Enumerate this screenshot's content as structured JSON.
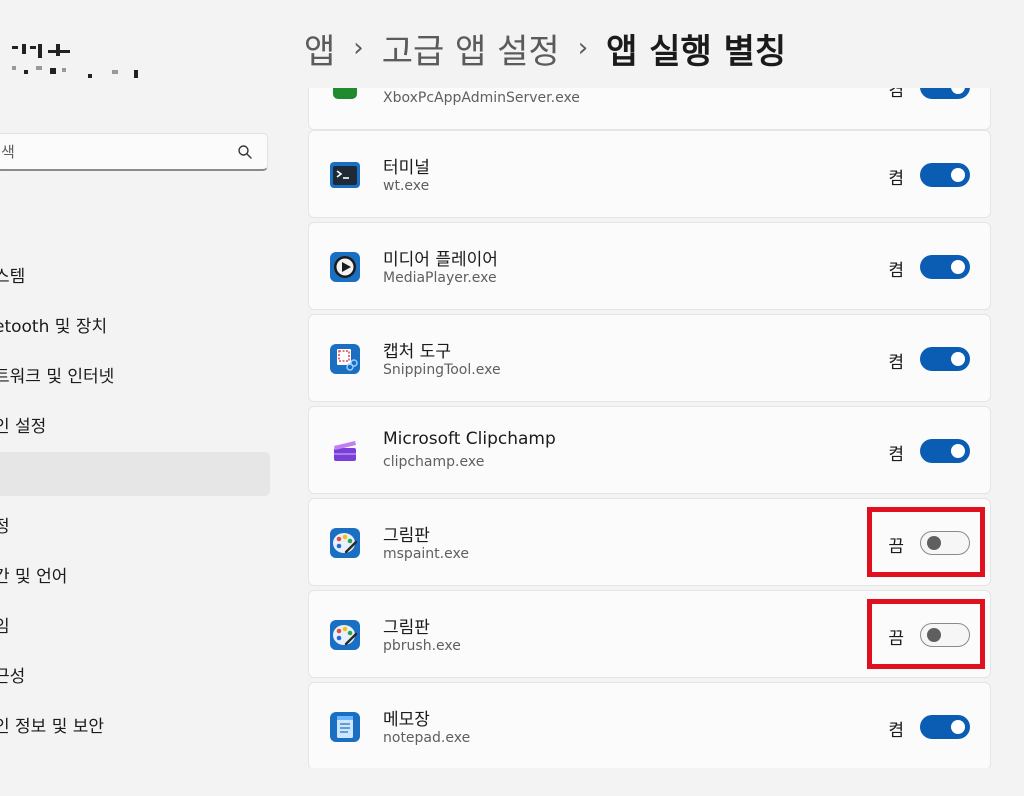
{
  "sidebar": {
    "search": {
      "placeholder": "색"
    },
    "items": [
      {
        "label": "스템"
      },
      {
        "label": "etooth 및 장치"
      },
      {
        "label": "트워크 및 인터넷"
      },
      {
        "label": "인 설정"
      },
      {
        "label": "",
        "selected": true
      },
      {
        "label": "정"
      },
      {
        "label": "간 및 언어"
      },
      {
        "label": "임"
      },
      {
        "label": "근성"
      },
      {
        "label": "인 정보 및 보안"
      }
    ]
  },
  "header": {
    "breadcrumb": [
      "앱",
      "고급 앱 설정",
      "앱 실행 별칭"
    ],
    "separator": "›"
  },
  "apps": [
    {
      "name": "",
      "exe": "XboxPcAppAdminServer.exe",
      "state": "켬",
      "on": true,
      "icon": "xbox-icon"
    },
    {
      "name": "터미널",
      "exe": "wt.exe",
      "state": "켬",
      "on": true,
      "icon": "terminal-icon"
    },
    {
      "name": "미디어 플레이어",
      "exe": "MediaPlayer.exe",
      "state": "켬",
      "on": true,
      "icon": "media-player-icon"
    },
    {
      "name": "캡처 도구",
      "exe": "SnippingTool.exe",
      "state": "켬",
      "on": true,
      "icon": "snipping-tool-icon"
    },
    {
      "name": "Microsoft Clipchamp",
      "exe": "clipchamp.exe",
      "state": "켬",
      "on": true,
      "icon": "clipchamp-icon"
    },
    {
      "name": "그림판",
      "exe": "mspaint.exe",
      "state": "끔",
      "on": false,
      "icon": "paint-icon"
    },
    {
      "name": "그림판",
      "exe": "pbrush.exe",
      "state": "끔",
      "on": false,
      "icon": "paint-icon"
    },
    {
      "name": "메모장",
      "exe": "notepad.exe",
      "state": "켬",
      "on": true,
      "icon": "notepad-icon"
    }
  ],
  "colors": {
    "accent": "#0b5cb3",
    "highlight": "#e0101e"
  }
}
